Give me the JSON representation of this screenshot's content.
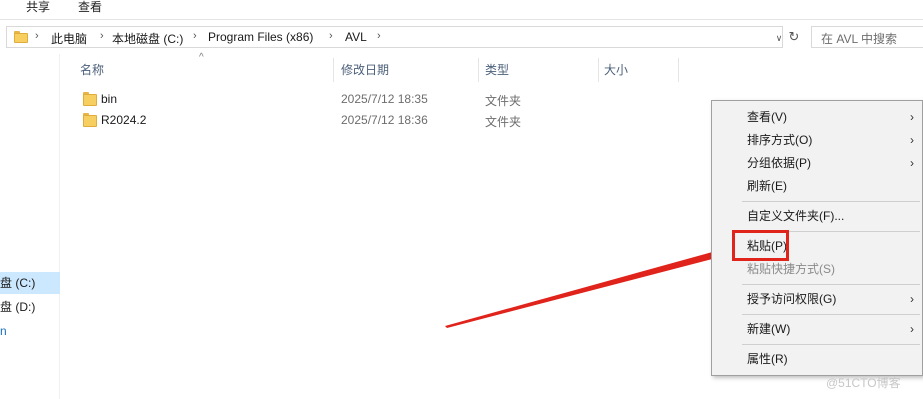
{
  "ribbon": {
    "tabs": [
      {
        "label": "共享"
      },
      {
        "label": "查看"
      }
    ]
  },
  "address": {
    "crumbs": [
      "此电脑",
      "本地磁盘 (C:)",
      "Program Files (x86)",
      "AVL"
    ],
    "search_placeholder": "在 AVL 中搜索"
  },
  "nav": {
    "items": [
      {
        "label": "盘 (C:)",
        "selected": true
      },
      {
        "label": "盘 (D:)",
        "selected": false
      }
    ]
  },
  "columns": {
    "name": "名称",
    "date": "修改日期",
    "type": "类型",
    "size": "大小"
  },
  "files": [
    {
      "name": "bin",
      "date": "2025/7/12 18:35",
      "type": "文件夹"
    },
    {
      "name": "R2024.2",
      "date": "2025/7/12 18:36",
      "type": "文件夹"
    }
  ],
  "context_menu": {
    "items": [
      {
        "label": "查看(V)",
        "submenu": true
      },
      {
        "label": "排序方式(O)",
        "submenu": true
      },
      {
        "label": "分组依据(P)",
        "submenu": true
      },
      {
        "label": "刷新(E)",
        "submenu": false
      },
      {
        "label": "自定义文件夹(F)...",
        "submenu": false
      },
      {
        "label": "粘贴(P)",
        "submenu": false,
        "highlighted": true
      },
      {
        "label": "粘贴快捷方式(S)",
        "submenu": false,
        "disabled": true
      },
      {
        "label": "授予访问权限(G)",
        "submenu": true
      },
      {
        "label": "新建(W)",
        "submenu": true
      },
      {
        "label": "属性(R)",
        "submenu": false
      }
    ],
    "submenu_glyph": "›"
  },
  "annotation": {
    "highlight_color": "#e0231b"
  },
  "watermark": "@51CTO博客"
}
